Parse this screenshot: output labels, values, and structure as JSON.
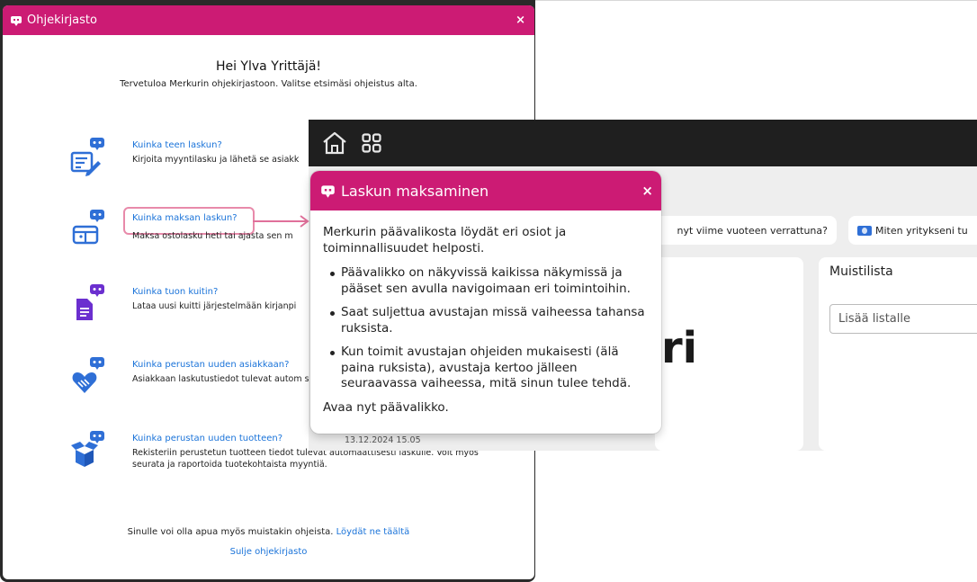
{
  "library": {
    "title": "Ohjekirjasto",
    "close": "×",
    "greeting": "Hei Ylva Yrittäjä!",
    "intro": "Tervetuloa Merkurin ohjekirjastoon. Valitse etsimäsi ohjeistus alta.",
    "items": [
      {
        "icon": "invoice-write-icon",
        "link": "Kuinka teen laskun?",
        "desc": "Kirjoita myyntilasku ja lähetä se asiakk"
      },
      {
        "icon": "wallet-icon",
        "link": "Kuinka maksan laskun?",
        "desc": "Maksa ostolasku heti tai ajasta sen m"
      },
      {
        "icon": "receipt-icon",
        "link": "Kuinka tuon kuitin?",
        "desc": "Lataa uusi kuitti järjestelmään kirjanpi"
      },
      {
        "icon": "handshake-heart-icon",
        "link": "Kuinka perustan uuden asiakkaan?",
        "desc": "Asiakkaan laskutustiedot tulevat autom seurata ja raportoida asiakkaalle teht"
      },
      {
        "icon": "box-icon",
        "link": "Kuinka perustan uuden tuotteen?",
        "desc": "Rekisteriin perustetun tuotteen tiedot tulevat automaattisesti laskulle. Voit myös seurata ja raportoida tuotekohtaista myyntiä."
      }
    ],
    "footer_text": "Sinulle voi olla apua myös muistakin ohjeista.",
    "footer_link": "Löydät ne täältä",
    "close_link": "Sulje ohjekirjasto"
  },
  "app": {
    "chip1": "nyt viime vuoteen verrattuna?",
    "chip2": "Miten yritykseni tu",
    "big_text": "ri",
    "notes_title": "Muistilista",
    "notes_placeholder": "Lisää listalle",
    "date": "13.12.2024 15.05"
  },
  "guide": {
    "title": "Laskun maksaminen",
    "close": "×",
    "lead": "Merkurin päävalikosta löydät eri osiot ja toiminnallisuudet helposti.",
    "bullets": [
      "Päävalikko on näkyvissä kaikissa näkymissä ja pääset sen avulla navigoimaan eri toimintoihin.",
      "Saat suljettua avustajan missä vaiheessa tahansa ruksista.",
      "Kun toimit avustajan ohjeiden mukaisesti (älä paina ruksista), avustaja kertoo jälleen seuraavassa vaiheessa, mitä sinun tulee tehdä."
    ],
    "final": "Avaa nyt päävalikko."
  },
  "colors": {
    "brand": "#cc1b74",
    "icon_blue": "#2f6fd6",
    "link": "#1a73d9",
    "highlight": "#e88aaa"
  }
}
